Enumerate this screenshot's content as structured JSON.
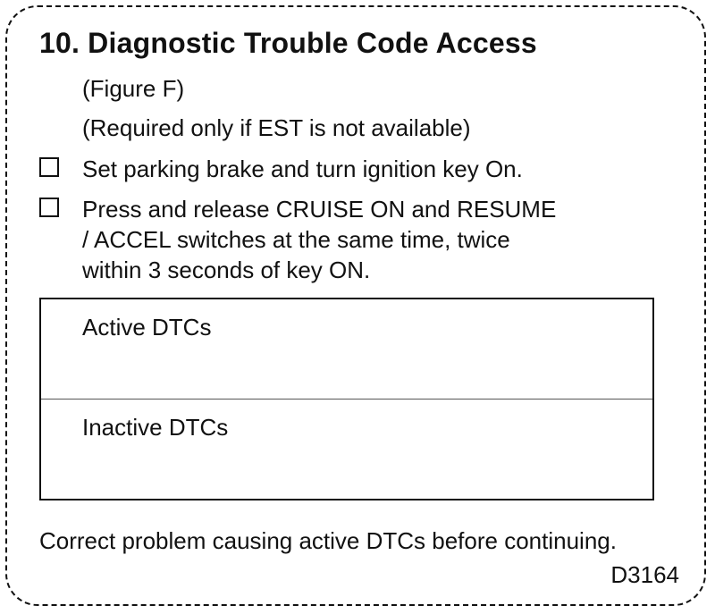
{
  "section": {
    "title": "10. Diagnostic Trouble Code Access",
    "figure_ref": "(Figure F)",
    "requirement_note": "(Required only if EST is not available)"
  },
  "steps": [
    {
      "lines": [
        "Set parking brake and turn ignition key On."
      ]
    },
    {
      "lines": [
        "Press and release CRUISE ON and RESUME",
        "/ ACCEL switches at the same time, twice",
        "within 3 seconds of key ON."
      ]
    }
  ],
  "dtc_table": {
    "active_label": "Active DTCs",
    "inactive_label": "Inactive DTCs"
  },
  "footer": {
    "note": "Correct problem causing active DTCs before continuing.",
    "code": "D3164"
  }
}
